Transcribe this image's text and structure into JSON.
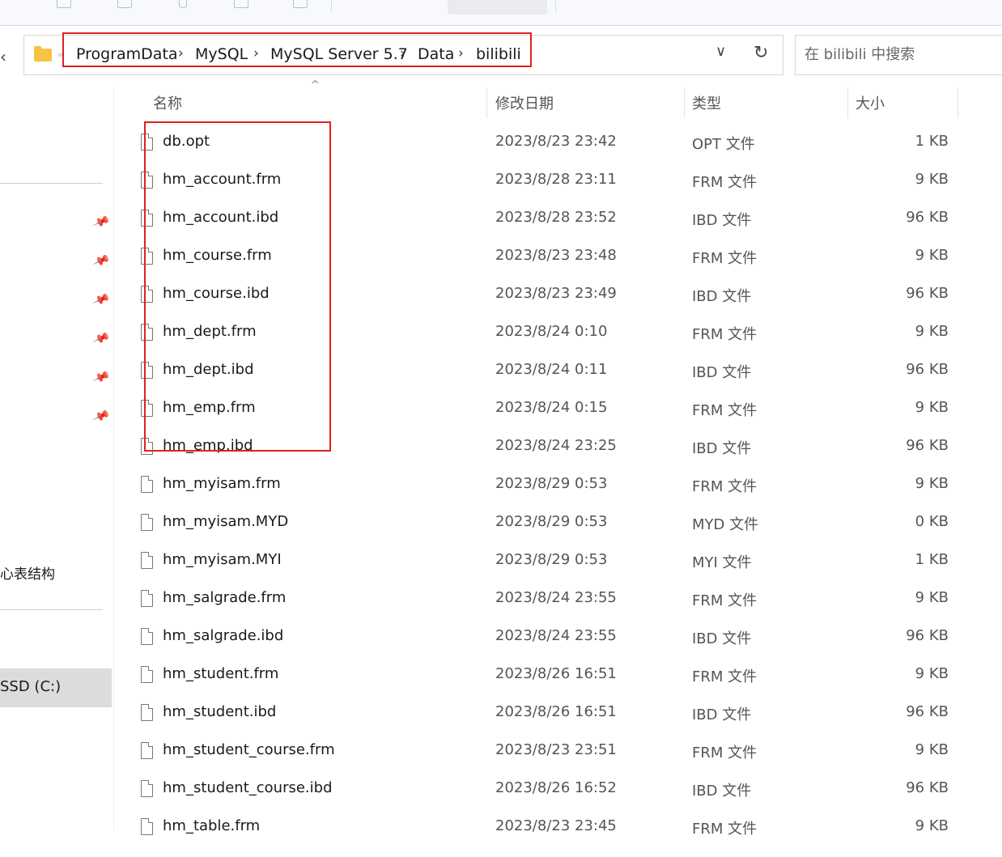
{
  "address_bar": {
    "breadcrumbs": [
      "ProgramData",
      "MySQL",
      "MySQL Server 5.7",
      "Data",
      "bilibili"
    ],
    "overflow_glyph": "«",
    "back_glyph": "‹",
    "dropdown_glyph": "∨",
    "refresh_glyph": "↻"
  },
  "search": {
    "placeholder": "在 bilibili 中搜索"
  },
  "sidebar": {
    "quick_access_label": "心表结构",
    "drive_label": "SSD (C:)",
    "pin_glyph": "📌"
  },
  "columns": {
    "name": "名称",
    "date": "修改日期",
    "type": "类型",
    "size": "大小",
    "sort_glyph": "^"
  },
  "files": [
    {
      "name": "db.opt",
      "date": "2023/8/23 23:42",
      "type": "OPT 文件",
      "size": "1 KB"
    },
    {
      "name": "hm_account.frm",
      "date": "2023/8/28 23:11",
      "type": "FRM 文件",
      "size": "9 KB"
    },
    {
      "name": "hm_account.ibd",
      "date": "2023/8/28 23:52",
      "type": "IBD 文件",
      "size": "96 KB"
    },
    {
      "name": "hm_course.frm",
      "date": "2023/8/23 23:48",
      "type": "FRM 文件",
      "size": "9 KB"
    },
    {
      "name": "hm_course.ibd",
      "date": "2023/8/23 23:49",
      "type": "IBD 文件",
      "size": "96 KB"
    },
    {
      "name": "hm_dept.frm",
      "date": "2023/8/24 0:10",
      "type": "FRM 文件",
      "size": "9 KB"
    },
    {
      "name": "hm_dept.ibd",
      "date": "2023/8/24 0:11",
      "type": "IBD 文件",
      "size": "96 KB"
    },
    {
      "name": "hm_emp.frm",
      "date": "2023/8/24 0:15",
      "type": "FRM 文件",
      "size": "9 KB"
    },
    {
      "name": "hm_emp.ibd",
      "date": "2023/8/24 23:25",
      "type": "IBD 文件",
      "size": "96 KB"
    },
    {
      "name": "hm_myisam.frm",
      "date": "2023/8/29 0:53",
      "type": "FRM 文件",
      "size": "9 KB"
    },
    {
      "name": "hm_myisam.MYD",
      "date": "2023/8/29 0:53",
      "type": "MYD 文件",
      "size": "0 KB"
    },
    {
      "name": "hm_myisam.MYI",
      "date": "2023/8/29 0:53",
      "type": "MYI 文件",
      "size": "1 KB"
    },
    {
      "name": "hm_salgrade.frm",
      "date": "2023/8/24 23:55",
      "type": "FRM 文件",
      "size": "9 KB"
    },
    {
      "name": "hm_salgrade.ibd",
      "date": "2023/8/24 23:55",
      "type": "IBD 文件",
      "size": "96 KB"
    },
    {
      "name": "hm_student.frm",
      "date": "2023/8/26 16:51",
      "type": "FRM 文件",
      "size": "9 KB"
    },
    {
      "name": "hm_student.ibd",
      "date": "2023/8/26 16:51",
      "type": "IBD 文件",
      "size": "96 KB"
    },
    {
      "name": "hm_student_course.frm",
      "date": "2023/8/23 23:51",
      "type": "FRM 文件",
      "size": "9 KB"
    },
    {
      "name": "hm_student_course.ibd",
      "date": "2023/8/26 16:52",
      "type": "IBD 文件",
      "size": "96 KB"
    },
    {
      "name": "hm_table.frm",
      "date": "2023/8/23 23:45",
      "type": "FRM 文件",
      "size": "9 KB"
    }
  ],
  "colors": {
    "highlight": "#e02020",
    "folder": "#f6c343",
    "selected_bg": "#dcdcdc"
  }
}
